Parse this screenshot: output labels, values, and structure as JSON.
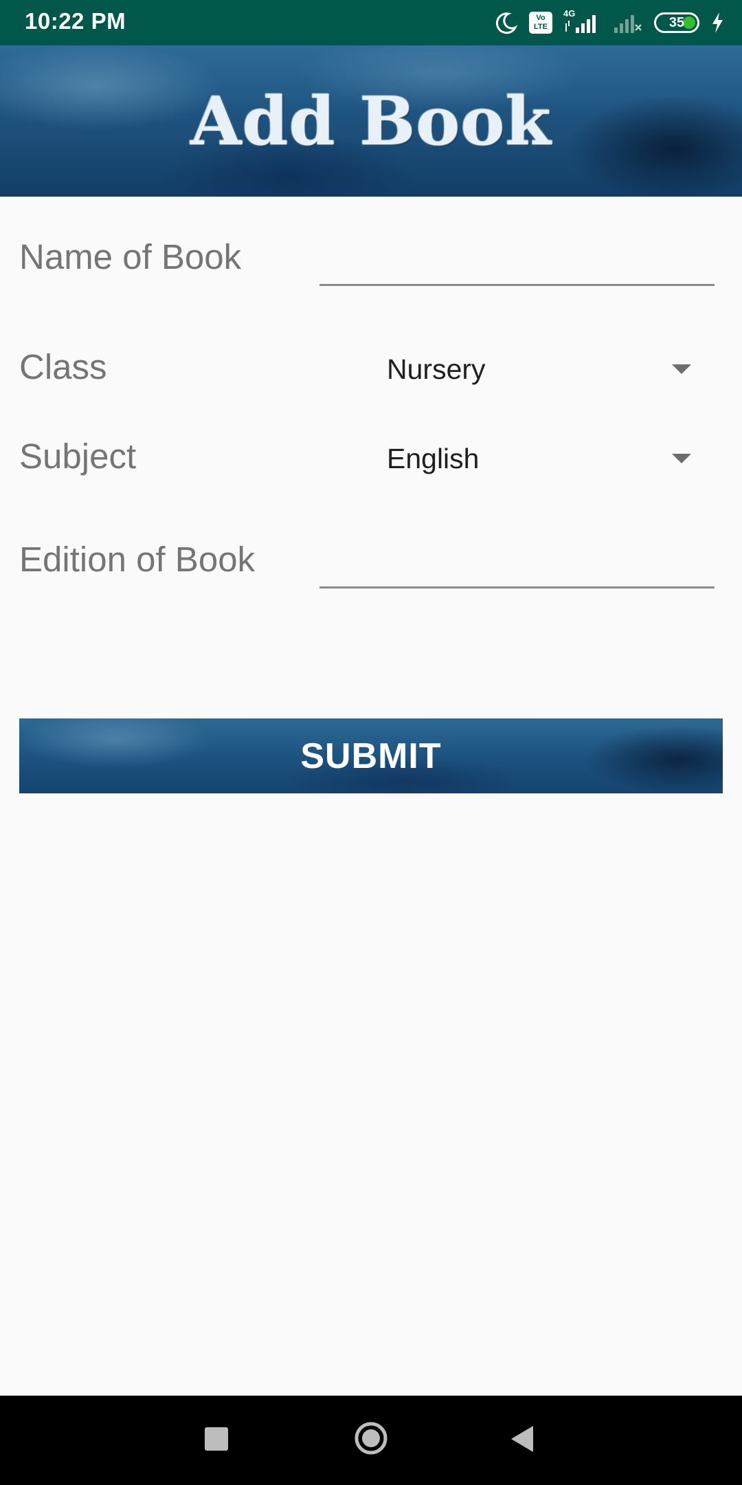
{
  "status_bar": {
    "time": "10:22 PM",
    "network_type": "4G",
    "volte_badge": "Vo LTE",
    "battery_level": "35",
    "icons": [
      "moon-icon",
      "volte-icon",
      "signal-icon",
      "signal-no-service-icon",
      "battery-icon",
      "charging-icon"
    ]
  },
  "header": {
    "title": "Add Book"
  },
  "form": {
    "name_label": "Name of Book",
    "name_value": "",
    "class_label": "Class",
    "class_value": "Nursery",
    "subject_label": "Subject",
    "subject_value": "English",
    "edition_label": "Edition of Book",
    "edition_value": ""
  },
  "submit": {
    "label": "SUBMIT"
  },
  "nav_bar": {
    "icons": [
      "recents-icon",
      "home-icon",
      "back-icon"
    ]
  },
  "colors": {
    "status_bar": "#01574a",
    "banner": "#1f5480",
    "background": "#fafafa",
    "label_text": "#757575",
    "battery_fill": "#35c02b"
  }
}
